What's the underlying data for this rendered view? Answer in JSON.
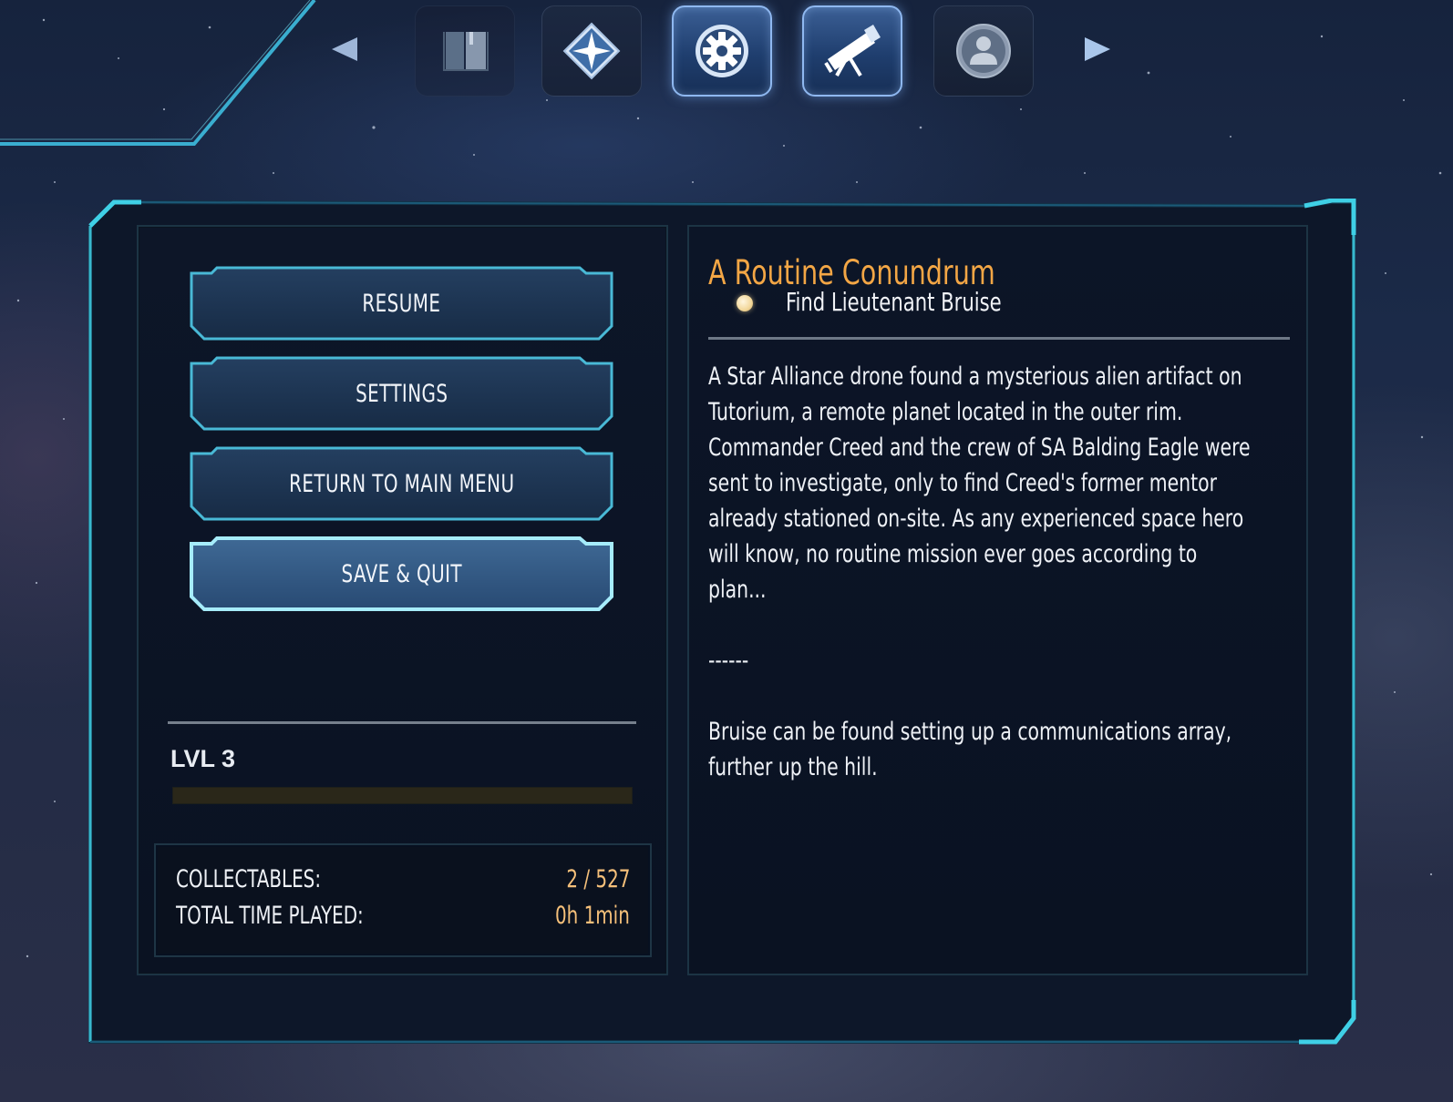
{
  "nav": {
    "tabs": [
      {
        "icon": "journal-icon",
        "active": false
      },
      {
        "icon": "compass-star-icon",
        "active": false
      },
      {
        "icon": "settings-gear-icon",
        "active": true
      },
      {
        "icon": "telescope-icon",
        "active": true
      },
      {
        "icon": "profile-icon",
        "active": false
      }
    ]
  },
  "menu": {
    "resume": "RESUME",
    "settings": "SETTINGS",
    "return_main": "RETURN TO MAIN MENU",
    "save_quit": "SAVE & QUIT"
  },
  "player": {
    "level_label": "LVL 3",
    "xp_progress": 0.0
  },
  "stats": {
    "collectables_label": "COLLECTABLES:",
    "collectables_value": "2 / 527",
    "time_label": "TOTAL TIME PLAYED:",
    "time_value": "0h 1min"
  },
  "quest": {
    "title": "A Routine Conundrum",
    "objective": "Find Lieutenant Bruise",
    "description_lines": [
      "A Star Alliance drone found a mysterious alien artifact on",
      "Tutorium, a remote planet located in the outer rim.",
      "Commander Creed and the crew of SA Balding Eagle were",
      "sent to investigate, only to find Creed's former mentor",
      "already stationed on-site. As any experienced space hero",
      "will know, no routine mission ever goes according to",
      "plan..."
    ],
    "separator": "------",
    "hint_lines": [
      "Bruise can be found setting up a communications array,",
      "further up the hill."
    ]
  },
  "colors": {
    "accent_cyan": "#3fd0e6",
    "quest_orange": "#f3a645",
    "value_gold": "#f5c07a"
  }
}
